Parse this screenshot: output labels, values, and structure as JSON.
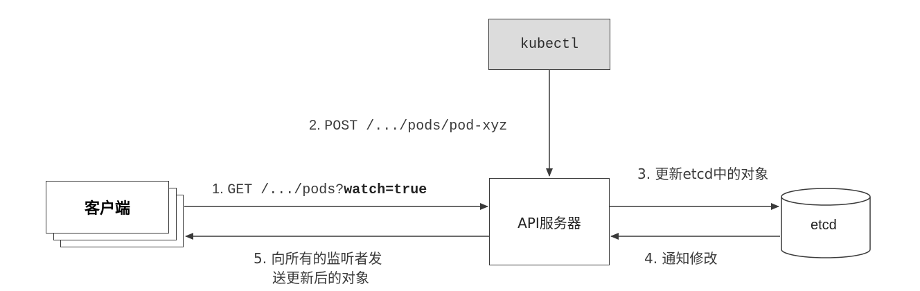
{
  "nodes": {
    "kubectl": "kubectl",
    "client": "客户端",
    "api_server": "API服务器",
    "etcd": "etcd"
  },
  "edges": {
    "step1_prefix": "1. ",
    "step1_path": "GET /.../pods?",
    "step1_bold": "watch=true",
    "step2_prefix": "2. ",
    "step2_path": "POST /.../pods/pod-xyz",
    "step3": "3. 更新etcd中的对象",
    "step4": "4. 通知修改",
    "step5_line1": "5. 向所有的监听者发",
    "step5_line2": "送更新后的对象"
  }
}
